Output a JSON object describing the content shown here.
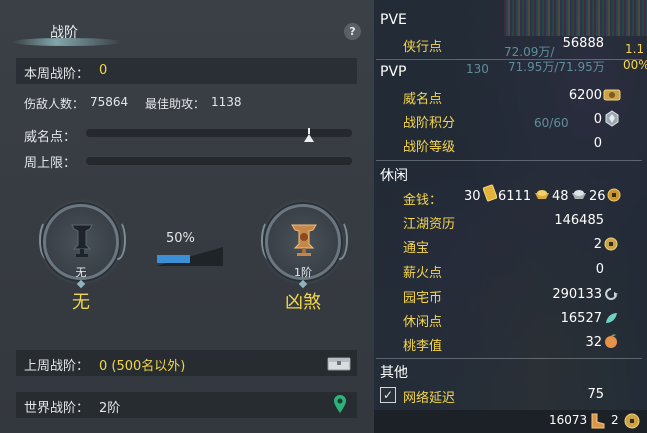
{
  "left": {
    "tab_title": "战阶",
    "help_label": "?",
    "weekly_rank_label": "本周战阶：",
    "weekly_rank_value": "0",
    "enemies_hurt_label": "伤敌人数：",
    "enemies_hurt_value": "75864",
    "best_assist_label": "最佳助攻：",
    "best_assist_value": "1138",
    "prestige_label": "威名点：",
    "weekly_cap_label": "周上限：",
    "current_medal_caption": "无",
    "current_medal_title": "无",
    "progress_percent_text": "50%",
    "progress_fraction": 0.5,
    "next_medal_caption": "1阶",
    "next_medal_title": "凶煞",
    "last_week_label": "上周战阶：",
    "last_week_value": "0 (500名以外)",
    "world_rank_label": "世界战阶：",
    "world_rank_value": "2阶"
  },
  "right": {
    "pve_header": "PVE",
    "pve_items": [
      {
        "label": "侠行点",
        "value": "56888"
      }
    ],
    "pvp_header": "PVP",
    "pvp_items": [
      {
        "label": "威名点",
        "value": "6200"
      },
      {
        "label": "战阶积分",
        "value": "0"
      },
      {
        "label": "战阶等级",
        "value": "0"
      }
    ],
    "leisure_header": "休闲",
    "money_label": "金钱：",
    "money_gold": "30",
    "money_silver_big": "6111",
    "money_silver": "48",
    "money_copper": "26",
    "leisure_items": [
      {
        "label": "江湖资历",
        "value": "146485"
      },
      {
        "label": "通宝",
        "value": "2"
      },
      {
        "label": "薪火点",
        "value": "0"
      },
      {
        "label": "园宅币",
        "value": "290133"
      },
      {
        "label": "休闲点",
        "value": "16527"
      },
      {
        "label": "桃李值",
        "value": "32"
      }
    ],
    "other_header": "其他",
    "latency_label": "网络延迟",
    "latency_value": "75",
    "footer_value_1": "16073",
    "footer_value_2": "2",
    "ghost_texts": [
      "72.09万/",
      "71.95万/71.95万",
      "130",
      "60/60",
      "1.1",
      "00%"
    ]
  },
  "colors": {
    "accent_yellow": "#f3d64a",
    "progress_blue": "#3d8fd6"
  }
}
